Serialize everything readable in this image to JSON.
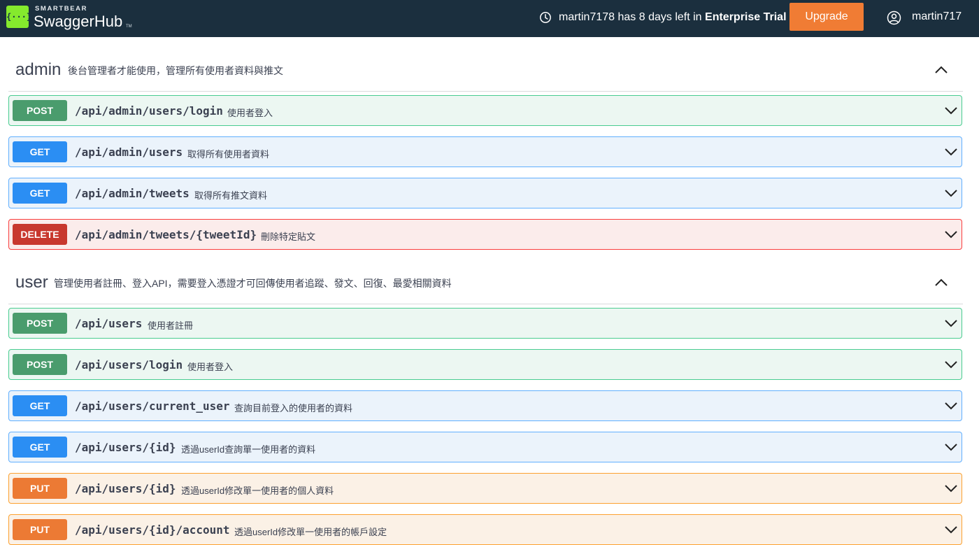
{
  "header": {
    "logo_glyph": "{···}",
    "brand_small": "SMARTBEAR",
    "brand_main": "SwaggerHub",
    "brand_tm": "TM",
    "trial_prefix": "martin7178 has 8 days left in",
    "trial_plan": "Enterprise Trial",
    "upgrade_label": "Upgrade",
    "username": "martin717",
    "bg_color": "#1b2f3e",
    "upgrade_color": "#f07c34"
  },
  "sections": [
    {
      "name": "admin",
      "description": "後台管理者才能使用，管理所有使用者資料與推文",
      "expanded": true,
      "operations": [
        {
          "method": "POST",
          "path": "/api/admin/users/login",
          "summary": "使用者登入"
        },
        {
          "method": "GET",
          "path": "/api/admin/users",
          "summary": "取得所有使用者資料"
        },
        {
          "method": "GET",
          "path": "/api/admin/tweets",
          "summary": "取得所有推文資料"
        },
        {
          "method": "DELETE",
          "path": "/api/admin/tweets/{tweetId}",
          "summary": "刪除特定貼文"
        }
      ]
    },
    {
      "name": "user",
      "description": "管理使用者註冊、登入API，需要登入憑證才可回傳使用者追蹤、發文、回復、最愛相關資料",
      "expanded": true,
      "operations": [
        {
          "method": "POST",
          "path": "/api/users",
          "summary": "使用者註冊"
        },
        {
          "method": "POST",
          "path": "/api/users/login",
          "summary": "使用者登入"
        },
        {
          "method": "GET",
          "path": "/api/users/current_user",
          "summary": "查詢目前登入的使用者的資料"
        },
        {
          "method": "GET",
          "path": "/api/users/{id}",
          "summary": "透過userId查詢單一使用者的資料"
        },
        {
          "method": "PUT",
          "path": "/api/users/{id}",
          "summary": "透過userId修改單一使用者的個人資料"
        },
        {
          "method": "PUT",
          "path": "/api/users/{id}/account",
          "summary": "透過userId修改單一使用者的帳戶設定"
        }
      ]
    }
  ],
  "method_colors": {
    "POST": "#4a9c6d",
    "GET": "#2b8ef3",
    "DELETE": "#c8382e",
    "PUT": "#ec7a34"
  }
}
